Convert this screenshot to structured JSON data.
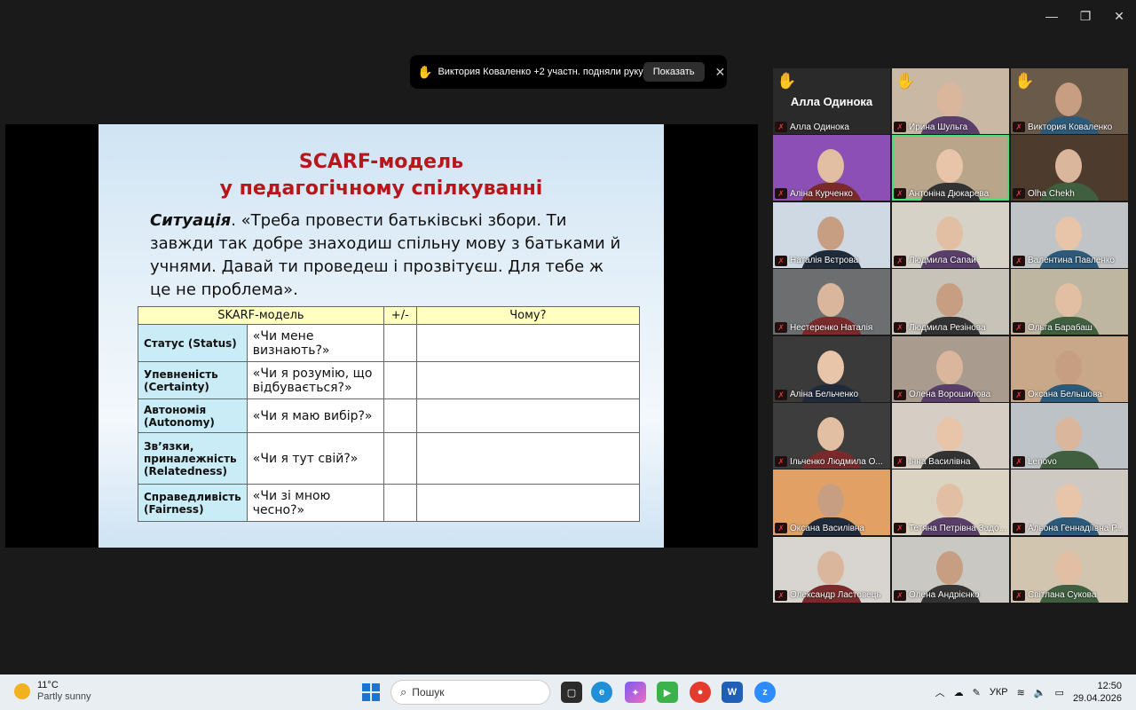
{
  "window": {
    "minimize": "—",
    "maximize": "❐",
    "close": "✕"
  },
  "notification": {
    "message": "Виктория Коваленко +2 участн. подняли руку",
    "button": "Показать"
  },
  "slide": {
    "title_line1": "SCARF-модель",
    "title_line2": "у педагогічному спілкуванні",
    "situation_label": "Ситуація",
    "situation_text": ". «Треба провести батьківські збори. Ти завжди так добре знаходиш спільну мову з батьками й учнями. Давай ти проведеш і прозвітуєш. Для тебе ж це не проблема».",
    "table": {
      "headers": [
        "SKARF-модель",
        "+/-",
        "Чому?"
      ],
      "rows": [
        {
          "label": "Статус (Status)",
          "question": "«Чи мене визнають?»"
        },
        {
          "label": "Упевненість (Certainty)",
          "question": "«Чи я розумію, що відбувається?»"
        },
        {
          "label": "Автономія (Autonomy)",
          "question": "«Чи я маю вибір?»"
        },
        {
          "label": "Зв’язки, приналежність (Relatedness)",
          "question": "«Чи я тут свій?»"
        },
        {
          "label": "Справедливість (Fairness)",
          "question": "«Чи зі мною чесно?»"
        }
      ]
    }
  },
  "participants": [
    {
      "name": "Алла Одинока",
      "big_name": "Алла Одинока",
      "hand": true
    },
    {
      "name": "Ирина Шульга",
      "hand": true
    },
    {
      "name": "Виктория Коваленко",
      "hand": true
    },
    {
      "name": "Аліна Курченко"
    },
    {
      "name": "Антоніна Дюкарева",
      "active": true
    },
    {
      "name": "Olha Chekh"
    },
    {
      "name": "Наталія Вєтрова"
    },
    {
      "name": "Людмила Сапай"
    },
    {
      "name": "Валентина Павленко"
    },
    {
      "name": "Нестеренко Наталія"
    },
    {
      "name": "Людмила Резінова"
    },
    {
      "name": "Ольга Барабаш"
    },
    {
      "name": "Аліна Бельченко"
    },
    {
      "name": "Олена Ворошилова"
    },
    {
      "name": "Оксана Бельшова"
    },
    {
      "name": "Ільченко Людмила О..."
    },
    {
      "name": "Інна Василівна"
    },
    {
      "name": "Lenovo"
    },
    {
      "name": "Оксана Василівна"
    },
    {
      "name": "Тетяна Петрівна Задо..."
    },
    {
      "name": "Альона Геннадіївна Р..."
    },
    {
      "name": "Олександр Ластовець"
    },
    {
      "name": "Олена Андрієнко"
    },
    {
      "name": "Світлана Сукова"
    }
  ],
  "taskbar": {
    "temperature": "11°C",
    "weather": "Partly sunny",
    "search_placeholder": "Пошук",
    "language": "УКР",
    "time": "12:50",
    "date": "29.04.2026"
  }
}
